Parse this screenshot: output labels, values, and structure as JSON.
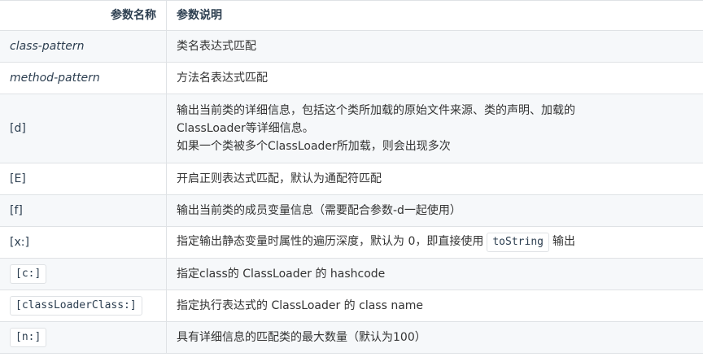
{
  "table": {
    "header": {
      "name": "参数名称",
      "desc": "参数说明"
    },
    "rows": [
      {
        "name": "class-pattern",
        "desc": "类名表达式匹配"
      },
      {
        "name": "method-pattern",
        "desc": "方法名表达式匹配"
      },
      {
        "name": "[d]",
        "desc_line1": "输出当前类的详细信息，包括这个类所加载的原始文件来源、类的声明、加载的",
        "desc_line2": "ClassLoader等详细信息。",
        "desc_line3": "如果一个类被多个ClassLoader所加载，则会出现多次"
      },
      {
        "name": "[E]",
        "desc": "开启正则表达式匹配，默认为通配符匹配"
      },
      {
        "name": "[f]",
        "desc": "输出当前类的成员变量信息（需要配合参数-d一起使用）"
      },
      {
        "name": "[x:]",
        "desc_before": "指定输出静态变量时属性的遍历深度，默认为 0，即直接使用",
        "desc_code": "toString",
        "desc_after": "输出"
      },
      {
        "name": "[c:]",
        "desc": "指定class的 ClassLoader 的 hashcode"
      },
      {
        "name": "[classLoaderClass:]",
        "desc": "指定执行表达式的 ClassLoader 的 class name"
      },
      {
        "name": "[n:]",
        "desc": "具有详细信息的匹配类的最大数量（默认为100）"
      }
    ]
  }
}
